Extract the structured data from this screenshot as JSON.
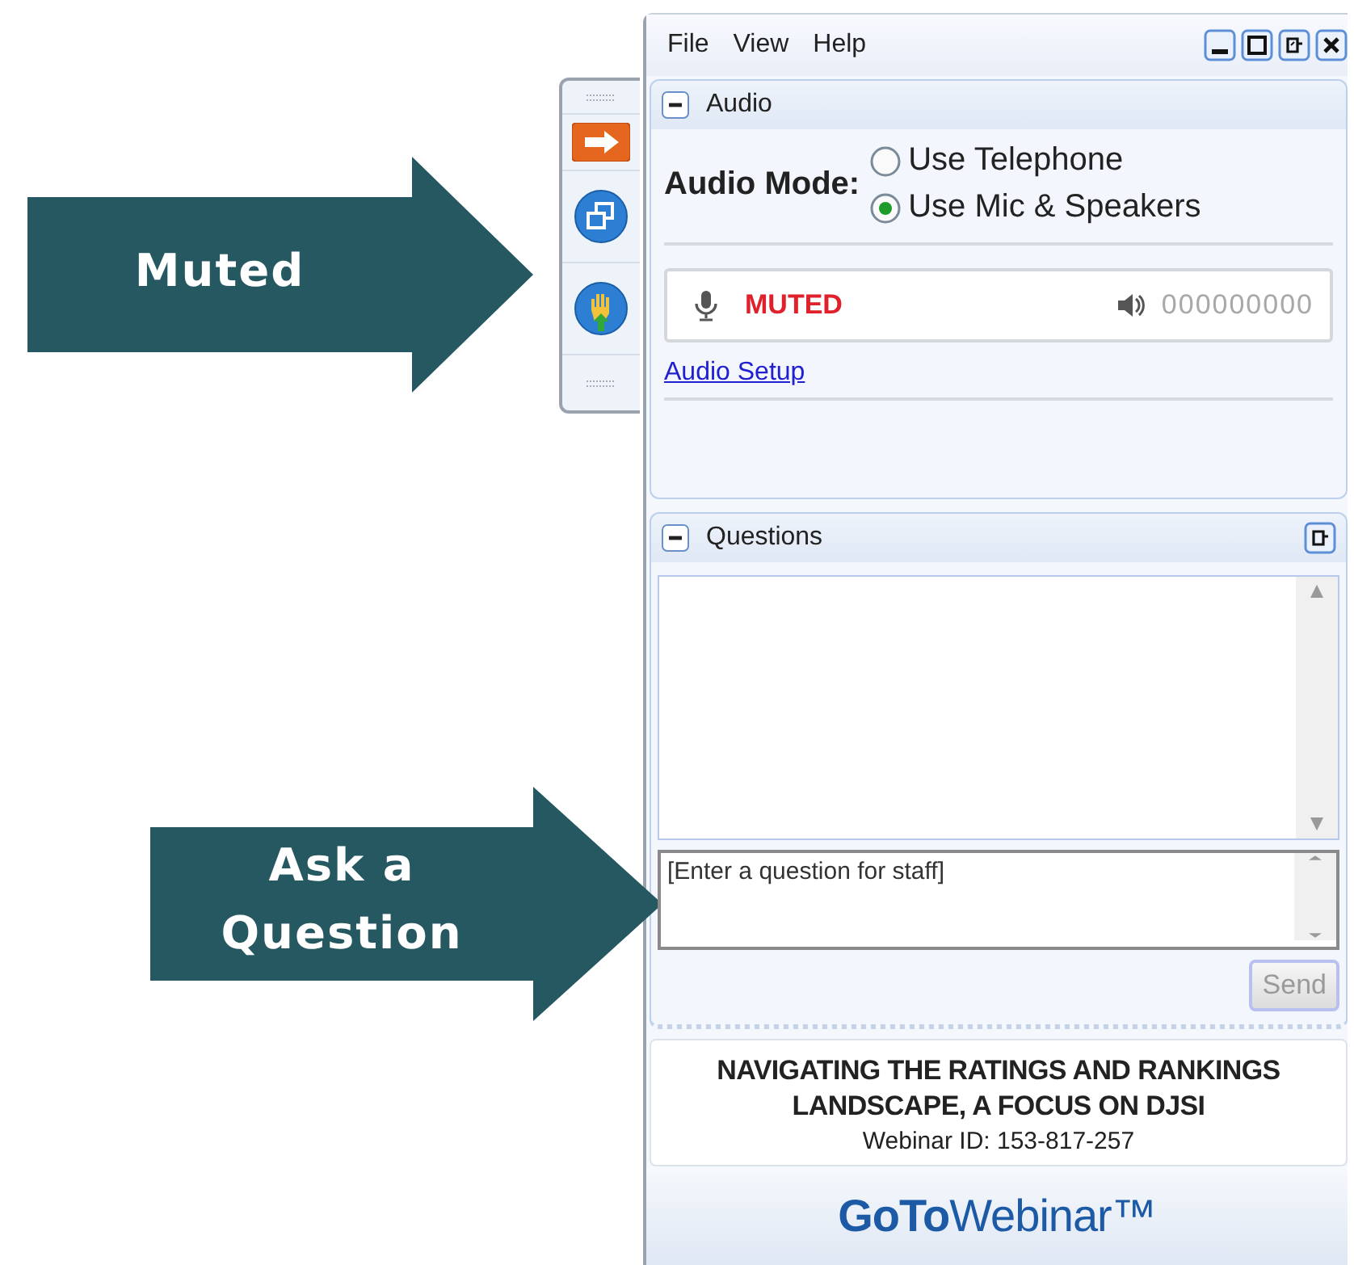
{
  "callouts": [
    {
      "text": "Muted"
    },
    {
      "text": "Ask a Question"
    }
  ],
  "menu": [
    "File",
    "View",
    "Help"
  ],
  "audio": {
    "title": "Audio",
    "expanded": true,
    "mode_label": "Audio Mode:",
    "options": [
      {
        "label": "Use Telephone",
        "selected": false
      },
      {
        "label": "Use Mic & Speakers",
        "selected": true
      }
    ],
    "status": "MUTED",
    "pin": "000000000",
    "setup_link": "Audio Setup"
  },
  "questions": {
    "title": "Questions",
    "expanded": true,
    "placeholder": "[Enter a question for staff]",
    "send": "Send",
    "send_disabled": true
  },
  "webinar": {
    "title": "NAVIGATING THE RATINGS AND RANKINGS LANDSCAPE, A FOCUS ON DJSI",
    "id": "Webinar ID: 153-817-257"
  },
  "logo": "**GoTo**Webinar™"
}
